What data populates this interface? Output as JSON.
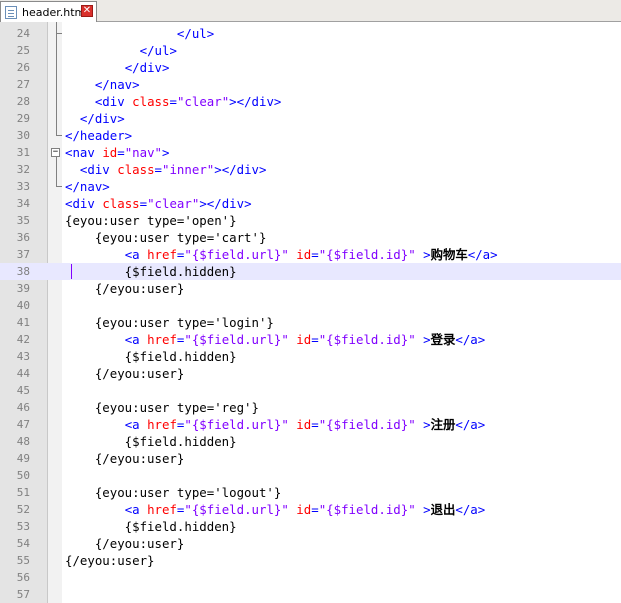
{
  "tab": {
    "filename": "header.htm",
    "close_glyph": "✕"
  },
  "colors": {
    "tag": "#0000ff",
    "attribute": "#ff0000",
    "value": "#8000ff",
    "text": "#000000",
    "current_line": "#e8e8ff"
  },
  "editor": {
    "current_line": 38,
    "lines": [
      {
        "n": "24",
        "segs": [
          [
            "               ",
            ""
          ],
          [
            "</ul>",
            "tag"
          ]
        ]
      },
      {
        "n": "25",
        "segs": [
          [
            "          ",
            ""
          ],
          [
            "</ul>",
            "tag"
          ]
        ]
      },
      {
        "n": "26",
        "segs": [
          [
            "        ",
            ""
          ],
          [
            "</div>",
            "tag"
          ]
        ]
      },
      {
        "n": "27",
        "segs": [
          [
            "    ",
            ""
          ],
          [
            "</nav>",
            "tag"
          ]
        ]
      },
      {
        "n": "28",
        "segs": [
          [
            "    ",
            ""
          ],
          [
            "<div ",
            "tag"
          ],
          [
            "class",
            "attr"
          ],
          [
            "=",
            "tag"
          ],
          [
            "\"clear\"",
            "val"
          ],
          [
            "></div>",
            "tag"
          ]
        ]
      },
      {
        "n": "29",
        "segs": [
          [
            "  ",
            ""
          ],
          [
            "</div>",
            "tag"
          ]
        ]
      },
      {
        "n": "30",
        "segs": [
          [
            "</header>",
            "tag"
          ]
        ]
      },
      {
        "n": "31",
        "segs": [
          [
            "<nav ",
            "tag"
          ],
          [
            "id",
            "attr"
          ],
          [
            "=",
            "tag"
          ],
          [
            "\"nav\"",
            "val"
          ],
          [
            ">",
            "tag"
          ]
        ]
      },
      {
        "n": "32",
        "segs": [
          [
            "  ",
            ""
          ],
          [
            "<div ",
            "tag"
          ],
          [
            "class",
            "attr"
          ],
          [
            "=",
            "tag"
          ],
          [
            "\"inner\"",
            "val"
          ],
          [
            "></div>",
            "tag"
          ]
        ]
      },
      {
        "n": "33",
        "segs": [
          [
            "</nav>",
            "tag"
          ]
        ]
      },
      {
        "n": "34",
        "segs": [
          [
            "<div ",
            "tag"
          ],
          [
            "class",
            "attr"
          ],
          [
            "=",
            "tag"
          ],
          [
            "\"clear\"",
            "val"
          ],
          [
            "></div>",
            "tag"
          ]
        ]
      },
      {
        "n": "35",
        "segs": [
          [
            "{eyou:user type='open'}",
            ""
          ]
        ]
      },
      {
        "n": "36",
        "segs": [
          [
            "    {eyou:user type='cart'}",
            ""
          ]
        ]
      },
      {
        "n": "37",
        "segs": [
          [
            "        ",
            ""
          ],
          [
            "<a ",
            "tag"
          ],
          [
            "href",
            "attr"
          ],
          [
            "=",
            "tag"
          ],
          [
            "\"{$field.url}\"",
            "val"
          ],
          [
            " ",
            ""
          ],
          [
            "id",
            "attr"
          ],
          [
            "=",
            "tag"
          ],
          [
            "\"{$field.id}\"",
            "val"
          ],
          [
            " >",
            "tag"
          ],
          [
            "购物车",
            "cjk"
          ],
          [
            "</a>",
            "tag"
          ]
        ]
      },
      {
        "n": "38",
        "segs": [
          [
            "        {$field.hidden}",
            ""
          ]
        ]
      },
      {
        "n": "39",
        "segs": [
          [
            "    {/eyou:user}",
            ""
          ]
        ]
      },
      {
        "n": "40",
        "segs": []
      },
      {
        "n": "41",
        "segs": [
          [
            "    {eyou:user type='login'}",
            ""
          ]
        ]
      },
      {
        "n": "42",
        "segs": [
          [
            "        ",
            ""
          ],
          [
            "<a ",
            "tag"
          ],
          [
            "href",
            "attr"
          ],
          [
            "=",
            "tag"
          ],
          [
            "\"{$field.url}\"",
            "val"
          ],
          [
            " ",
            ""
          ],
          [
            "id",
            "attr"
          ],
          [
            "=",
            "tag"
          ],
          [
            "\"{$field.id}\"",
            "val"
          ],
          [
            " >",
            "tag"
          ],
          [
            "登录",
            "cjk"
          ],
          [
            "</a>",
            "tag"
          ]
        ]
      },
      {
        "n": "43",
        "segs": [
          [
            "        {$field.hidden}",
            ""
          ]
        ]
      },
      {
        "n": "44",
        "segs": [
          [
            "    {/eyou:user}",
            ""
          ]
        ]
      },
      {
        "n": "45",
        "segs": []
      },
      {
        "n": "46",
        "segs": [
          [
            "    {eyou:user type='reg'}",
            ""
          ]
        ]
      },
      {
        "n": "47",
        "segs": [
          [
            "        ",
            ""
          ],
          [
            "<a ",
            "tag"
          ],
          [
            "href",
            "attr"
          ],
          [
            "=",
            "tag"
          ],
          [
            "\"{$field.url}\"",
            "val"
          ],
          [
            " ",
            ""
          ],
          [
            "id",
            "attr"
          ],
          [
            "=",
            "tag"
          ],
          [
            "\"{$field.id}\"",
            "val"
          ],
          [
            " >",
            "tag"
          ],
          [
            "注册",
            "cjk"
          ],
          [
            "</a>",
            "tag"
          ]
        ]
      },
      {
        "n": "48",
        "segs": [
          [
            "        {$field.hidden}",
            ""
          ]
        ]
      },
      {
        "n": "49",
        "segs": [
          [
            "    {/eyou:user}",
            ""
          ]
        ]
      },
      {
        "n": "50",
        "segs": []
      },
      {
        "n": "51",
        "segs": [
          [
            "    {eyou:user type='logout'}",
            ""
          ]
        ]
      },
      {
        "n": "52",
        "segs": [
          [
            "        ",
            ""
          ],
          [
            "<a ",
            "tag"
          ],
          [
            "href",
            "attr"
          ],
          [
            "=",
            "tag"
          ],
          [
            "\"{$field.url}\"",
            "val"
          ],
          [
            " ",
            ""
          ],
          [
            "id",
            "attr"
          ],
          [
            "=",
            "tag"
          ],
          [
            "\"{$field.id}\"",
            "val"
          ],
          [
            " >",
            "tag"
          ],
          [
            "退出",
            "cjk"
          ],
          [
            "</a>",
            "tag"
          ]
        ]
      },
      {
        "n": "53",
        "segs": [
          [
            "        {$field.hidden}",
            ""
          ]
        ]
      },
      {
        "n": "54",
        "segs": [
          [
            "    {/eyou:user}",
            ""
          ]
        ]
      },
      {
        "n": "55",
        "segs": [
          [
            "{/eyou:user}",
            ""
          ]
        ]
      },
      {
        "n": "56",
        "segs": []
      },
      {
        "n": "57",
        "segs": []
      }
    ]
  }
}
